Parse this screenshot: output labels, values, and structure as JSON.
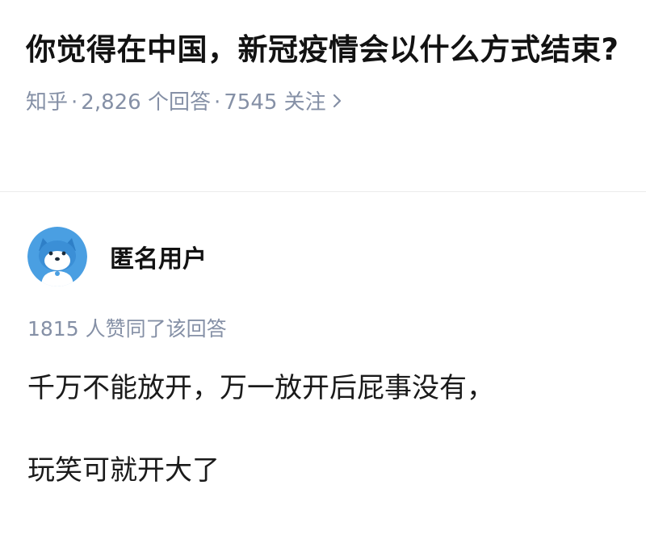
{
  "question": {
    "title": "你觉得在中国，新冠疫情会以什么方式结束?",
    "source": "知乎",
    "answer_count": "2,826 个回答",
    "follow_count": "7545 关注",
    "separator": "·"
  },
  "answer": {
    "author": "匿名用户",
    "likes_text": "1815 人赞同了该回答",
    "paragraphs": [
      "千万不能放开，万一放开后屁事没有，",
      "玩笑可就开大了"
    ]
  },
  "icons": {
    "meta_chevron": "chevron-right-icon",
    "avatar": "anonymous-mascot-icon"
  },
  "colors": {
    "text_primary": "#121212",
    "text_secondary": "#8590a6",
    "avatar_blue": "#4a9fe2"
  }
}
